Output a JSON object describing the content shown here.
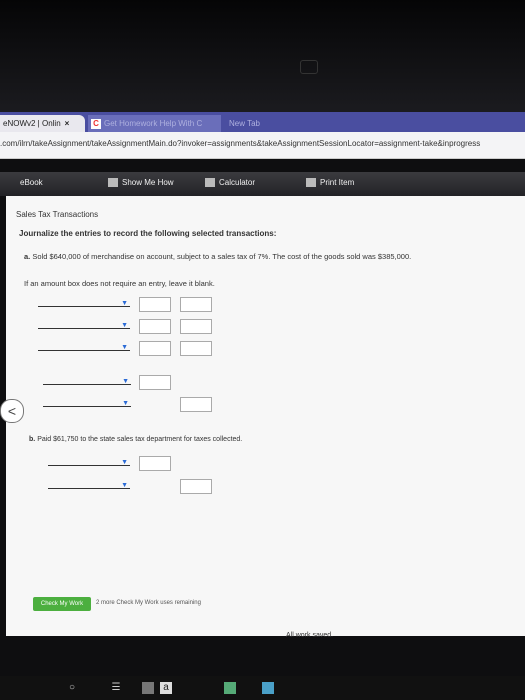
{
  "browser": {
    "tabs": [
      {
        "label": "eNOWv2 | Onlin",
        "close": "×"
      },
      {
        "label": "Get Homework Help With C"
      },
      {
        "label": "New Tab"
      }
    ],
    "url": ".com/ilrn/takeAssignment/takeAssignmentMain.do?invoker=assignments&takeAssignmentSessionLocator=assignment-take&inprogress"
  },
  "toolbar": {
    "ebook": "eBook",
    "show_me_how": "Show Me How",
    "calculator": "Calculator",
    "print_item": "Print Item"
  },
  "problem": {
    "title": "Sales Tax Transactions",
    "instruction": "Journalize the entries to record the following selected transactions:",
    "part_a_letter": "a.",
    "part_a_text": "Sold $640,000 of merchandise on account, subject to a sales tax of 7%. The cost of the goods sold was $385,000.",
    "note": "If an amount box does not require an entry, leave it blank.",
    "part_b_letter": "b.",
    "part_b_text": "Paid $61,750 to the state sales tax department for taxes collected."
  },
  "footer": {
    "check_my_work": "Check My Work",
    "remaining": "2 more Check My Work uses remaining",
    "saved": "All work saved."
  },
  "taskbar": {
    "icons": [
      "circle-icon",
      "ebook-icon",
      "app-icon",
      "a-icon",
      "photo-icon",
      "chrome-icon"
    ]
  }
}
